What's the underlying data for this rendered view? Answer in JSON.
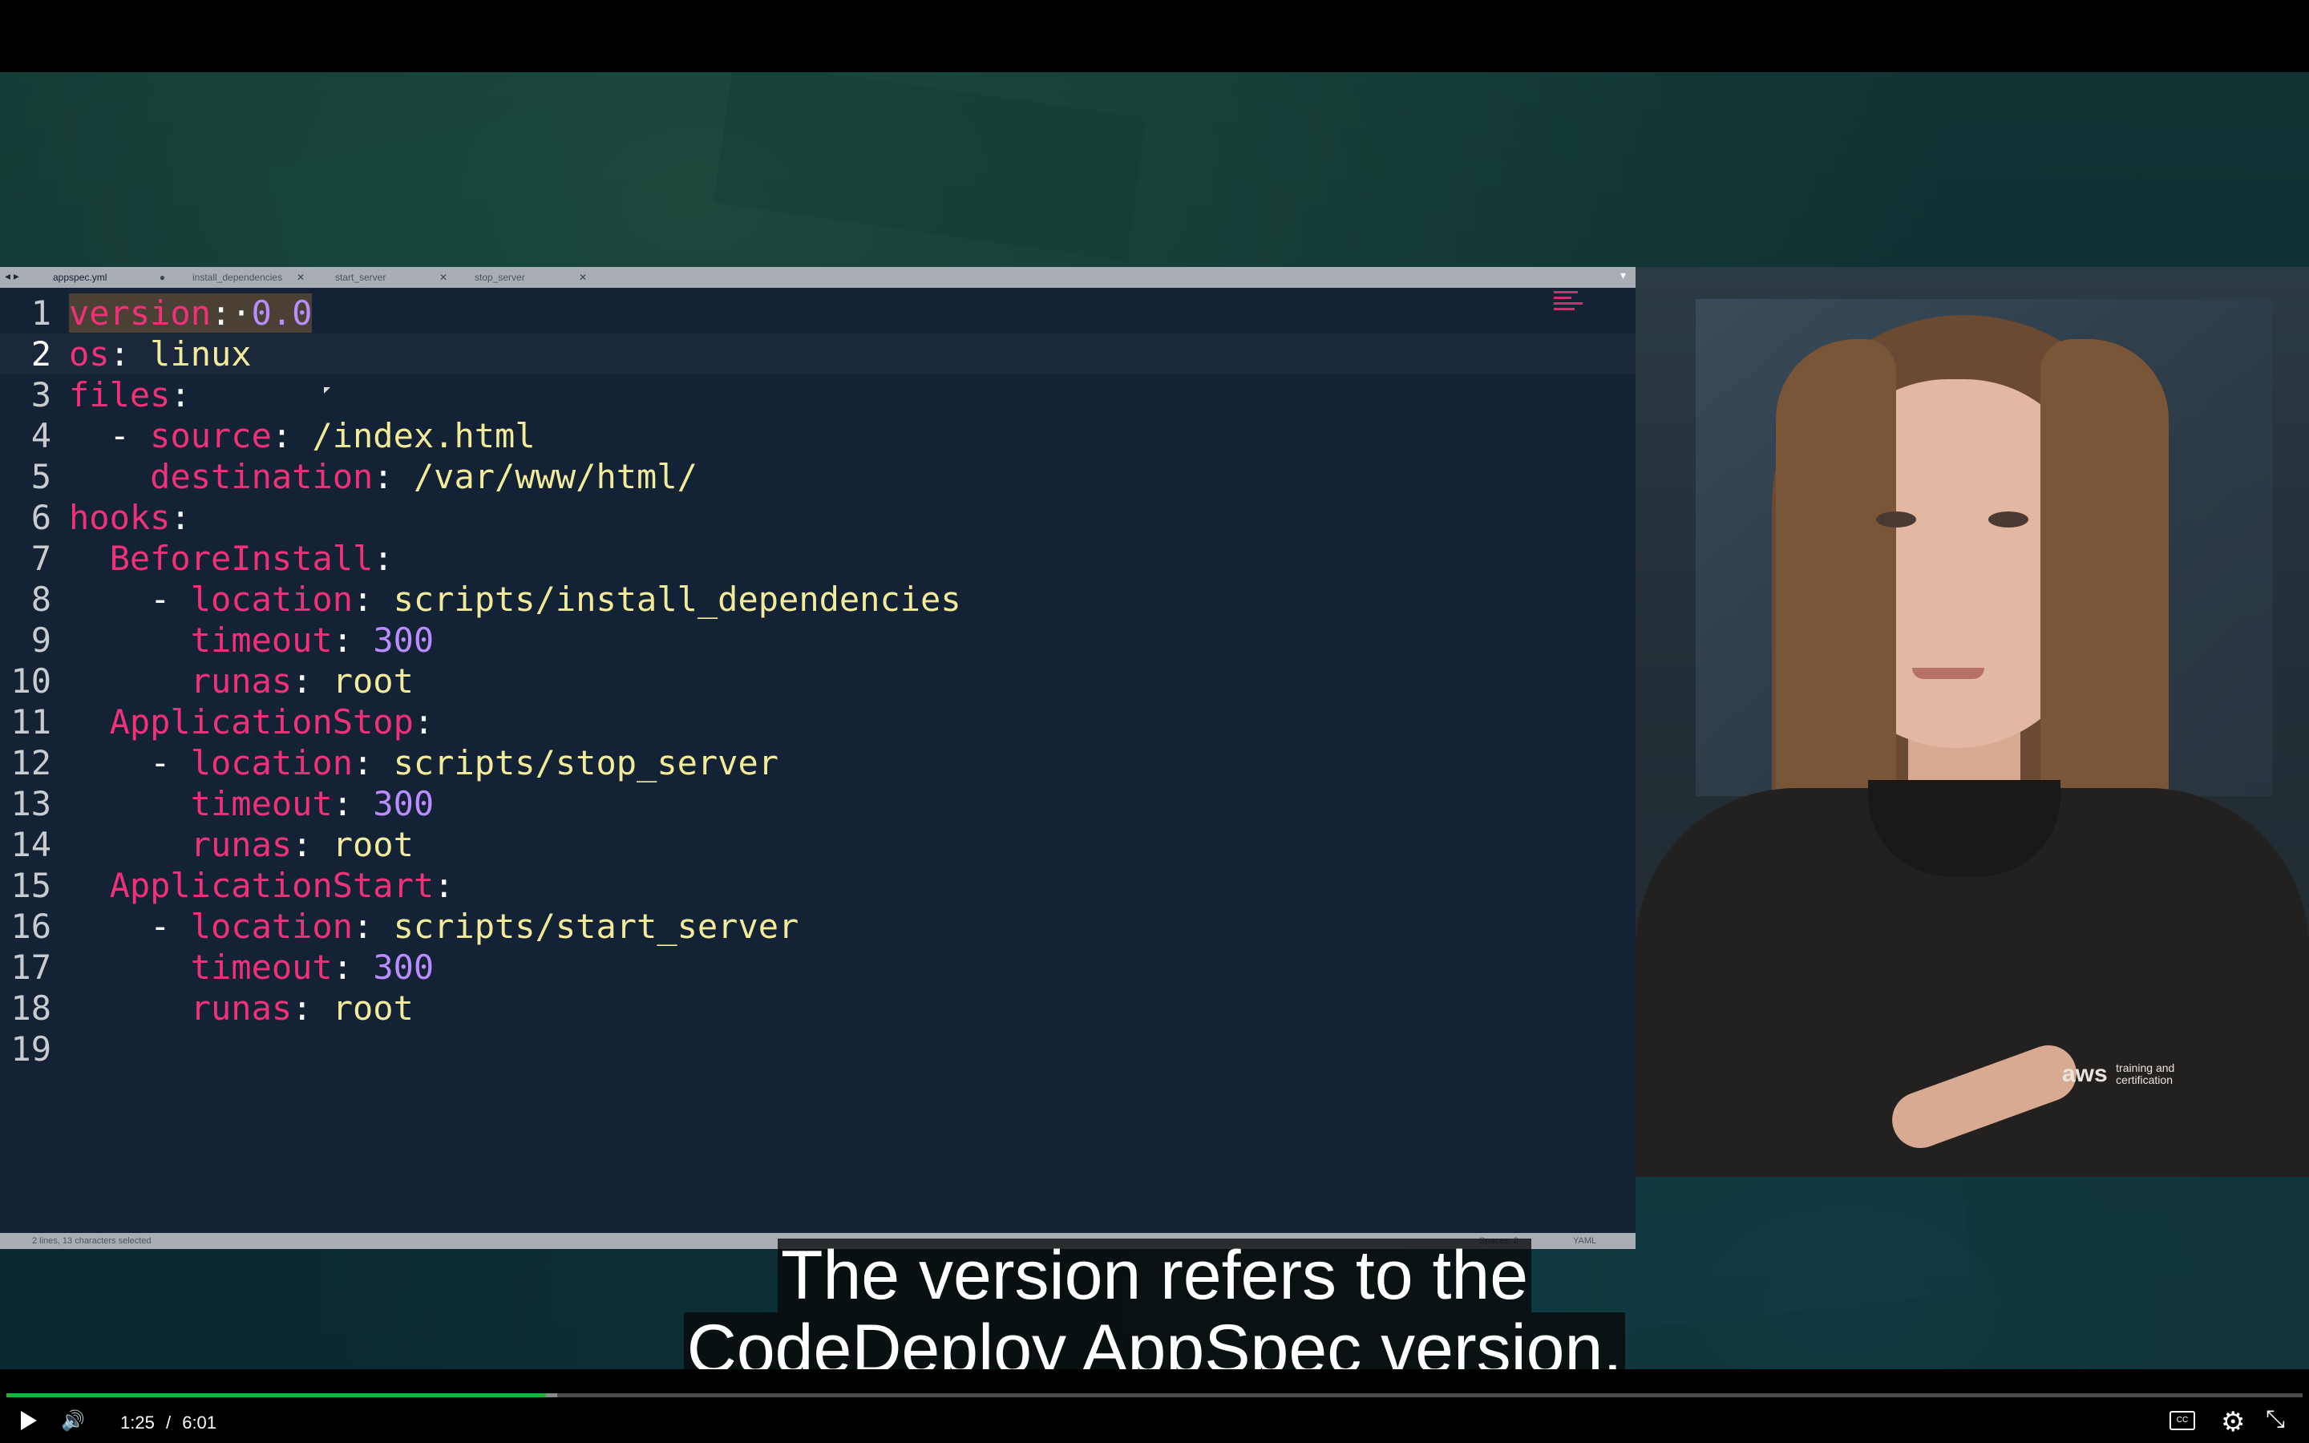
{
  "editor": {
    "tabs": [
      {
        "label": "appspec.yml",
        "active": true,
        "close": "●"
      },
      {
        "label": "install_dependencies",
        "active": false,
        "close": "✕"
      },
      {
        "label": "start_server",
        "active": false,
        "close": "✕"
      },
      {
        "label": "stop_server",
        "active": false,
        "close": "✕"
      }
    ],
    "nav_arrows": "◂ ▸",
    "tab_menu": "▾",
    "lines": [
      {
        "n": "1",
        "seg": [
          [
            "k",
            "version"
          ],
          [
            "p",
            ":"
          ],
          [
            "p",
            "·"
          ],
          [
            "n",
            "0.0"
          ]
        ]
      },
      {
        "n": "2",
        "seg": [
          [
            "k",
            "os"
          ],
          [
            "p",
            ": "
          ],
          [
            "v",
            "linux"
          ]
        ]
      },
      {
        "n": "3",
        "seg": [
          [
            "k",
            "files"
          ],
          [
            "p",
            ":"
          ]
        ]
      },
      {
        "n": "4",
        "seg": [
          [
            "p",
            "  - "
          ],
          [
            "k",
            "source"
          ],
          [
            "p",
            ": "
          ],
          [
            "v",
            "/index.html"
          ]
        ]
      },
      {
        "n": "5",
        "seg": [
          [
            "p",
            "    "
          ],
          [
            "k",
            "destination"
          ],
          [
            "p",
            ": "
          ],
          [
            "v",
            "/var/www/html/"
          ]
        ]
      },
      {
        "n": "6",
        "seg": [
          [
            "k",
            "hooks"
          ],
          [
            "p",
            ":"
          ]
        ]
      },
      {
        "n": "7",
        "seg": [
          [
            "p",
            "  "
          ],
          [
            "k",
            "BeforeInstall"
          ],
          [
            "p",
            ":"
          ]
        ]
      },
      {
        "n": "8",
        "seg": [
          [
            "p",
            "    - "
          ],
          [
            "k",
            "location"
          ],
          [
            "p",
            ": "
          ],
          [
            "v",
            "scripts/install_dependencies"
          ]
        ]
      },
      {
        "n": "9",
        "seg": [
          [
            "p",
            "      "
          ],
          [
            "k",
            "timeout"
          ],
          [
            "p",
            ": "
          ],
          [
            "n",
            "300"
          ]
        ]
      },
      {
        "n": "10",
        "seg": [
          [
            "p",
            "      "
          ],
          [
            "k",
            "runas"
          ],
          [
            "p",
            ": "
          ],
          [
            "v",
            "root"
          ]
        ]
      },
      {
        "n": "11",
        "seg": [
          [
            "p",
            "  "
          ],
          [
            "k",
            "ApplicationStop"
          ],
          [
            "p",
            ":"
          ]
        ]
      },
      {
        "n": "12",
        "seg": [
          [
            "p",
            "    - "
          ],
          [
            "k",
            "location"
          ],
          [
            "p",
            ": "
          ],
          [
            "v",
            "scripts/stop_server"
          ]
        ]
      },
      {
        "n": "13",
        "seg": [
          [
            "p",
            "      "
          ],
          [
            "k",
            "timeout"
          ],
          [
            "p",
            ": "
          ],
          [
            "n",
            "300"
          ]
        ]
      },
      {
        "n": "14",
        "seg": [
          [
            "p",
            "      "
          ],
          [
            "k",
            "runas"
          ],
          [
            "p",
            ": "
          ],
          [
            "v",
            "root"
          ]
        ]
      },
      {
        "n": "15",
        "seg": [
          [
            "p",
            "  "
          ],
          [
            "k",
            "ApplicationStart"
          ],
          [
            "p",
            ":"
          ]
        ]
      },
      {
        "n": "16",
        "seg": [
          [
            "p",
            "    - "
          ],
          [
            "k",
            "location"
          ],
          [
            "p",
            ": "
          ],
          [
            "v",
            "scripts/start_server"
          ]
        ]
      },
      {
        "n": "17",
        "seg": [
          [
            "p",
            "      "
          ],
          [
            "k",
            "timeout"
          ],
          [
            "p",
            ": "
          ],
          [
            "n",
            "300"
          ]
        ]
      },
      {
        "n": "18",
        "seg": [
          [
            "p",
            "      "
          ],
          [
            "k",
            "runas"
          ],
          [
            "p",
            ": "
          ],
          [
            "v",
            "root"
          ]
        ]
      },
      {
        "n": "19",
        "seg": []
      }
    ],
    "current_line": 2,
    "status": {
      "selection": "2 lines, 13 characters selected",
      "spaces": "Spaces: 2",
      "syntax": "YAML"
    }
  },
  "presenter": {
    "logo_text": "aws",
    "logo_sub": "training and certification"
  },
  "captions": {
    "line1": "The version refers to the",
    "line2": "CodeDeploy AppSpec version,"
  },
  "player": {
    "current_time": "1:25",
    "separator": "/",
    "duration": "6:01",
    "progress_fraction": 0.235,
    "buffered_fraction": 0.24,
    "progress_color": "#1db33f",
    "icons": {
      "play": "play-icon",
      "volume": "volume-icon",
      "captions": "closed-captions-icon",
      "settings": "gear-icon",
      "fullscreen": "exit-fullscreen-icon"
    },
    "volume_glyph": "🔊",
    "settings_glyph": "⚙",
    "fullscreen_glyph": "⤡",
    "cc_glyph": "CC"
  }
}
